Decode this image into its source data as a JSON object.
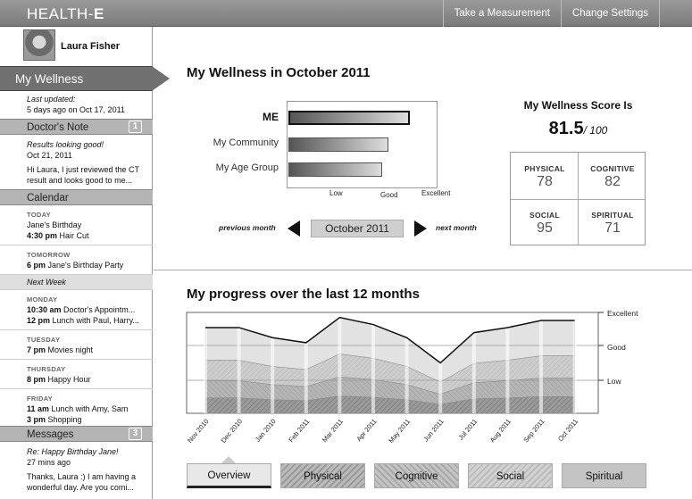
{
  "app": {
    "logo_a": "HEALTH-",
    "logo_b": "E"
  },
  "topnav": {
    "take_measurement": "Take a Measurement",
    "change_settings": "Change Settings"
  },
  "profile": {
    "name": "Laura Fisher"
  },
  "nav": {
    "my_wellness": "My Wellness"
  },
  "updated": {
    "label": "Last updated:",
    "value": "5 days ago on Oct 17, 2011"
  },
  "doctors_note": {
    "title": "Doctor's Note",
    "count": "1",
    "subject": "Results looking good!",
    "date": "Oct 21, 2011",
    "body1": "Hi Laura, I just reviewed the CT",
    "body2": "result and looks good to me..."
  },
  "calendar": {
    "title": "Calendar",
    "today": {
      "day": "TODAY",
      "l1": "Jane's Birthday",
      "t2": "4:30 pm",
      "l2": "Hair Cut"
    },
    "tomorrow": {
      "day": "TOMORROW",
      "t1": "6 pm",
      "l1": "Jane's Birthday Party"
    },
    "next_week": "Next Week",
    "monday": {
      "day": "MONDAY",
      "t1": "10:30 am",
      "l1": "Doctor's Appointm...",
      "t2": "12 pm",
      "l2": "Lunch with Paul, Harry..."
    },
    "tuesday": {
      "day": "TUESDAY",
      "t1": "7 pm",
      "l1": "Movies night"
    },
    "thursday": {
      "day": "THURSDAY",
      "t1": "8 pm",
      "l1": "Happy Hour"
    },
    "friday": {
      "day": "FRIDAY",
      "t1": "11 am",
      "l1": "Lunch with Amy, Sam",
      "t2": "3 pm",
      "l2": "Shopping"
    }
  },
  "messages": {
    "title": "Messages",
    "count": "3",
    "subject": "Re: Happy Birthday Jane!",
    "time": "27 mins ago",
    "body1": "Thanks, Laura :) I am having a",
    "body2": "wonderful day. Are you comi..."
  },
  "wellness": {
    "title": "My Wellness in October 2011",
    "prev": "previous month",
    "next": "next month",
    "month": "October 2011",
    "score_title": "My Wellness Score Is",
    "score": "81.5",
    "score_max": "/ 100",
    "categories": [
      {
        "label": "PHYSICAL",
        "value": "78"
      },
      {
        "label": "COGNITIVE",
        "value": "82"
      },
      {
        "label": "SOCIAL",
        "value": "95"
      },
      {
        "label": "SPIRITUAL",
        "value": "71"
      }
    ]
  },
  "chart_data": [
    {
      "type": "bar",
      "categories": [
        "ME",
        "My Community",
        "My Age Group"
      ],
      "values": [
        0.88,
        0.72,
        0.68
      ],
      "tick_labels": [
        "Low",
        "Good",
        "Excellent"
      ],
      "xlim": [
        0,
        1
      ]
    },
    {
      "type": "area",
      "title": "My progress over the last 12 months",
      "x": [
        "Nov 2010",
        "Dec 2010",
        "Jan 2010",
        "Feb 2011",
        "Mar 2011",
        "Apr 2011",
        "May 2011",
        "Jun 2011",
        "Jul 2011",
        "Aug 2011",
        "Sep 2011",
        "Oct 2011"
      ],
      "y_levels": [
        "Excellent",
        "Good",
        "Low"
      ],
      "total": [
        0.85,
        0.85,
        0.75,
        0.7,
        0.95,
        0.88,
        0.75,
        0.5,
        0.8,
        0.85,
        0.92,
        0.92
      ]
    }
  ],
  "tabs": [
    "Overview",
    "Physical",
    "Cognitive",
    "Social",
    "Spiritual"
  ]
}
